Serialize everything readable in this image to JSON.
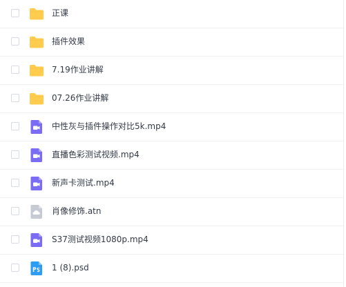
{
  "files": [
    {
      "name": "正课",
      "type": "folder"
    },
    {
      "name": "插件效果",
      "type": "folder"
    },
    {
      "name": "7.19作业讲解",
      "type": "folder"
    },
    {
      "name": "07.26作业讲解",
      "type": "folder"
    },
    {
      "name": "中性灰与插件操作对比5k.mp4",
      "type": "video"
    },
    {
      "name": "直播色彩测试视频.mp4",
      "type": "video"
    },
    {
      "name": "新声卡测试.mp4",
      "type": "video"
    },
    {
      "name": "肖像修饰.atn",
      "type": "cloud-file"
    },
    {
      "name": "S37测试视频1080p.mp4",
      "type": "video"
    },
    {
      "name": "1 (8).psd",
      "type": "photoshop"
    }
  ],
  "colors": {
    "folder": "#ffcc4d",
    "folder_tab": "#f5b82e",
    "video": "#7b6cf6",
    "cloud_file": "#c5cad3",
    "photoshop": "#2d9cf2"
  }
}
